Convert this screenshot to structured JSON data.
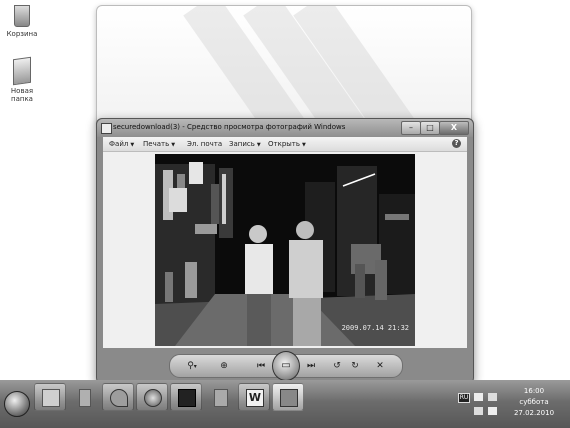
{
  "desktop": {
    "icons": [
      {
        "label": "Корзина"
      },
      {
        "label": "Новая папка"
      }
    ]
  },
  "viewer": {
    "title": "securedownload(3) - Средство просмотра фотографий Windows",
    "menu": [
      {
        "label": "Файл"
      },
      {
        "label": "Печать"
      },
      {
        "label": "Эл. почта"
      },
      {
        "label": "Запись"
      },
      {
        "label": "Открыть"
      }
    ],
    "help_glyph": "?",
    "photo_timestamp": "2009.07.14  21:32",
    "controls": {
      "zoom": "⚲",
      "zoom_caret": "▾",
      "fit": "⊕",
      "prev": "⏮",
      "slideshow": "▭",
      "next": "⏭",
      "rotate_ccw": "↺",
      "rotate_cw": "↻",
      "delete": "✕"
    },
    "window_buttons": {
      "minimize": "–",
      "maximize": "□",
      "close": "X"
    }
  },
  "taskbar": {
    "items": [
      {
        "icon": "library-icon"
      },
      {
        "icon": "media-icon"
      },
      {
        "icon": "satellite-icon"
      },
      {
        "icon": "firefox-icon"
      },
      {
        "icon": "floppy-icon"
      },
      {
        "icon": "recycle-icon"
      },
      {
        "icon": "word-icon"
      },
      {
        "icon": "photo-viewer-icon"
      }
    ],
    "tray": {
      "language": "RU"
    },
    "clock": {
      "time": "16:00",
      "day": "суббота",
      "date": "27.02.2010"
    }
  }
}
